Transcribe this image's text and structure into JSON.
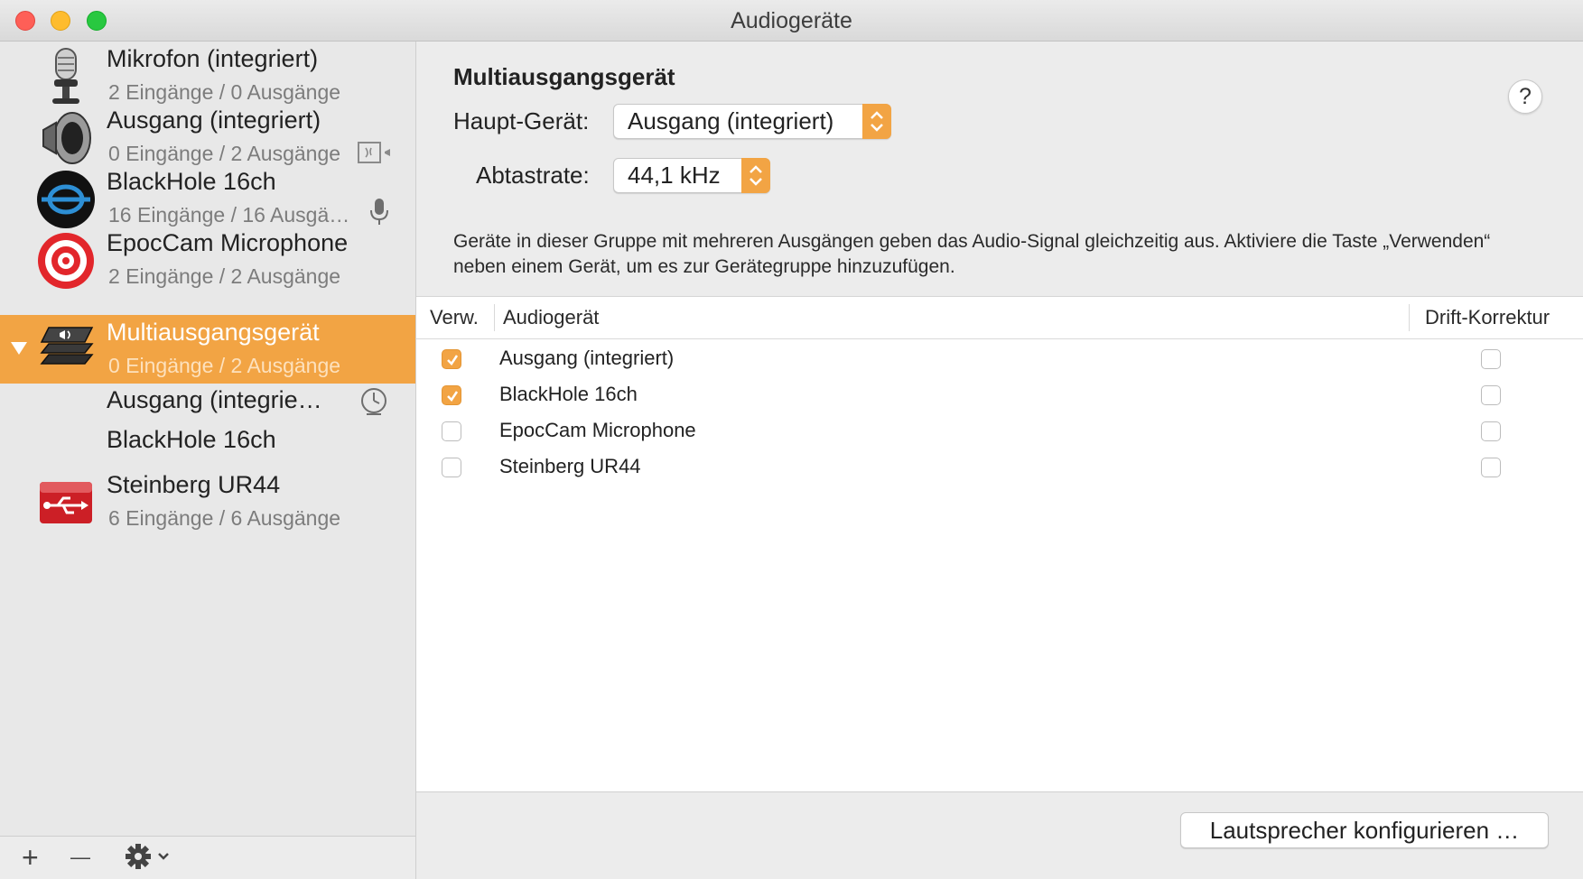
{
  "window": {
    "title": "Audiogeräte"
  },
  "sidebar": {
    "devices": [
      {
        "name": "Mikrofon (integriert)",
        "io": "2 Eingänge / 0 Ausgänge",
        "icon": "microphone-icon"
      },
      {
        "name": "Ausgang (integriert)",
        "io": "0 Eingänge / 2 Ausgänge",
        "icon": "speaker-icon"
      },
      {
        "name": "BlackHole 16ch",
        "io": "16 Eingänge / 16 Ausgä…",
        "icon": "blackhole-icon"
      },
      {
        "name": "EpocCam Microphone",
        "io": "2 Eingänge / 2 Ausgänge",
        "icon": "target-icon"
      },
      {
        "name": "Multiausgangsgerät",
        "io": "0 Eingänge / 2 Ausgänge",
        "icon": "multi-output-icon",
        "selected": true
      },
      {
        "name": "Steinberg UR44",
        "io": "6 Eingänge / 6 Ausgänge",
        "icon": "usb-audio-icon"
      }
    ],
    "sub_devices": [
      {
        "name": "Ausgang (integrie…"
      },
      {
        "name": "BlackHole 16ch"
      }
    ],
    "add_label": "+",
    "remove_label": "—"
  },
  "main": {
    "heading": "Multiausgangsgerät",
    "help_label": "?",
    "master_label": "Haupt-Gerät:",
    "master_value": "Ausgang (integriert)",
    "rate_label": "Abtastrate:",
    "rate_value": "44,1 kHz",
    "description": "Geräte in dieser Gruppe mit mehreren Ausgängen geben das Audio-Signal gleichzeitig aus. Aktiviere die Taste „Verwenden“ neben einem Gerät, um es zur Gerätegruppe hinzuzufügen.",
    "table": {
      "columns": [
        "Verw.",
        "Audiogerät",
        "Drift-Korrektur"
      ],
      "rows": [
        {
          "use": true,
          "device": "Ausgang (integriert)",
          "drift": false
        },
        {
          "use": true,
          "device": "BlackHole 16ch",
          "drift": false
        },
        {
          "use": false,
          "device": "EpocCam Microphone",
          "drift": false
        },
        {
          "use": false,
          "device": "Steinberg UR44",
          "drift": false
        }
      ]
    },
    "configure_button": "Lautsprecher konfigurieren …"
  },
  "colors": {
    "accent": "#f2a444",
    "close": "#fe5f57",
    "minimize": "#febc2e",
    "maximize": "#28c840"
  }
}
